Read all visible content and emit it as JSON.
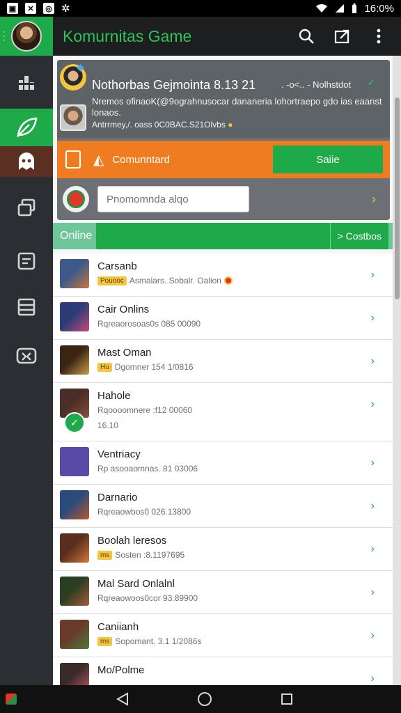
{
  "status_bar": {
    "time": "16:0%",
    "left_icons": [
      "gallery-icon",
      "close-app-icon",
      "steam-icon",
      "brightness-icon"
    ],
    "right_icons": [
      "wifi-icon",
      "signal-icon",
      "battery-icon"
    ]
  },
  "app_bar": {
    "title": "Komurnitas Game",
    "actions": [
      "search-icon",
      "share-icon",
      "more-vert-icon"
    ]
  },
  "rail": {
    "items": [
      {
        "icon": "stats-icon"
      },
      {
        "icon": "leaf-icon",
        "active": "green"
      },
      {
        "icon": "ghost-icon",
        "active": "brown"
      },
      {
        "icon": "layers-icon"
      },
      {
        "icon": "chat-icon"
      },
      {
        "icon": "list-icon"
      },
      {
        "icon": "gamepad-icon"
      }
    ]
  },
  "hero": {
    "title": "Nothorbas Gejmointa 8.13 21",
    "aside": ". -o<.. - Nolhstdot",
    "description": "Nremos ofinaoK(@9ograhnusocar dananeria lohortraepo gdo ias eaanst lonaos.",
    "meta": "Antrrmey,/. oass 0C0BAC.S21Olvbs"
  },
  "promo": {
    "label": "Comunntard",
    "button": "Saiie"
  },
  "search": {
    "placeholder": "Pnomomnda alqo"
  },
  "tabs": {
    "online": "Online",
    "collections": "> Costbos"
  },
  "games": [
    {
      "name": "Carsanb",
      "sub": "Asmalars. Sobalr. Oalion",
      "badge": "Pouooc",
      "extra": "",
      "colors": [
        "#3d5a8a",
        "#c7763a"
      ]
    },
    {
      "name": "Cair Onlins",
      "sub": "Rqreaorosoas0s 085 00090",
      "badge": "",
      "extra": "",
      "colors": [
        "#2d3c78",
        "#c34a7a"
      ]
    },
    {
      "name": "Mast Oman",
      "sub": "Dgomner 154 1/0816",
      "badge": "Hu",
      "extra": "",
      "colors": [
        "#3b2414",
        "#c89a4a"
      ]
    },
    {
      "name": "Hahole",
      "sub": "Rqoooomnere :f12 00060",
      "badge": "",
      "extra": "16.10",
      "colors": [
        "#4a2e28",
        "#8a4f3a"
      ]
    },
    {
      "name": "Ventriacy",
      "sub": "Rp asooaomnas. 81 03006",
      "badge": "",
      "extra": "",
      "colors": [
        "#5a4aa8",
        "#5a4aa8"
      ]
    },
    {
      "name": "Darnario",
      "sub": "Rqreaowbos0 026.13800",
      "badge": "",
      "extra": "",
      "colors": [
        "#2c4a7a",
        "#b75a2e"
      ]
    },
    {
      "name": "Boolah leresos",
      "sub": "Sosten :8.1197695",
      "badge": "ms",
      "extra": "",
      "colors": [
        "#5a2e1e",
        "#d27a3a"
      ]
    },
    {
      "name": "Mal Sard Onlalnl",
      "sub": "Rqreaowoos0cor 93.89900",
      "badge": "",
      "extra": "",
      "colors": [
        "#2c3e22",
        "#a85a3a"
      ]
    },
    {
      "name": "Caniianh",
      "sub": "Sopomant. 3.1 1/2086s",
      "badge": "ms",
      "extra": "",
      "colors": [
        "#6a3a2a",
        "#4a7a3a"
      ]
    },
    {
      "name": "Mo/Polme",
      "sub": "",
      "badge": "",
      "extra": "",
      "colors": [
        "#3a2a2a",
        "#b85a5a"
      ]
    }
  ],
  "nav_bar": {
    "buttons": [
      "back-icon",
      "home-icon",
      "recents-icon"
    ]
  },
  "colors": {
    "brand_green": "#1faa4a",
    "accent_orange": "#f07c21",
    "rail_bg": "#2b2e32",
    "appbar_bg": "#1c1e20"
  }
}
